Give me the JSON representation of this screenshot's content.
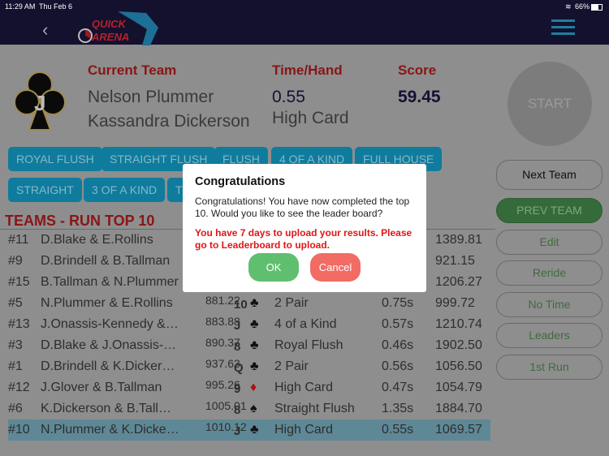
{
  "status": {
    "time": "11:29 AM",
    "date": "Thu Feb 6",
    "battery": "66%"
  },
  "header": {
    "logo_text": "QUICK ARENA",
    "back_icon": "chevron-left-icon",
    "menu_icon": "hamburger-icon"
  },
  "current": {
    "team_label": "Current Team",
    "member1": "Nelson Plummer",
    "member2": "Kassandra Dickerson",
    "time_label": "Time/Hand",
    "time": "0.55",
    "hand": "High Card",
    "score_label": "Score",
    "score": "59.45",
    "card_icon": "jack-of-clubs"
  },
  "hands": [
    "ROYAL FLUSH",
    "STRAIGHT FLUSH",
    "FLUSH",
    "4 OF A KIND",
    "FULL HOUSE",
    "STRAIGHT",
    "3 OF A KIND",
    "T"
  ],
  "list_title": "TEAMS - RUN TOP 10",
  "rows": [
    {
      "rank": "#11",
      "name": "D.Blake & E.Rollins",
      "time": "",
      "card": "",
      "suit": "",
      "hand": "",
      "th": "",
      "score": "1389.81"
    },
    {
      "rank": "#9",
      "name": "D.Brindell & B.Tallman",
      "time": "",
      "card": "",
      "suit": "",
      "hand": "",
      "th": "",
      "score": "921.15"
    },
    {
      "rank": "#15",
      "name": "B.Tallman & N.Plummer",
      "time": "",
      "card": "",
      "suit": "",
      "hand": "",
      "th": "",
      "score": "1206.27"
    },
    {
      "rank": "#5",
      "name": "N.Plummer & E.Rollins",
      "time": "881.22",
      "card": "10",
      "suit": "♣",
      "hand": "2 Pair",
      "th": "0.75s",
      "score": "999.72"
    },
    {
      "rank": "#13",
      "name": "J.Onassis-Kennedy & K.Dickerson",
      "time": "883.88",
      "card": "J",
      "suit": "♣",
      "hand": "4 of a Kind",
      "th": "0.57s",
      "score": "1210.74"
    },
    {
      "rank": "#3",
      "name": "D.Blake & J.Onassis-Kennedy",
      "time": "890.37",
      "card": "8",
      "suit": "♣",
      "hand": "Royal Flush",
      "th": "0.46s",
      "score": "1902.50"
    },
    {
      "rank": "#1",
      "name": "D.Brindell & K.Dickerson",
      "time": "937.63",
      "card": "Q",
      "suit": "♣",
      "hand": "2 Pair",
      "th": "0.56s",
      "score": "1056.50"
    },
    {
      "rank": "#12",
      "name": "J.Glover & B.Tallman",
      "time": "995.26",
      "card": "9",
      "suit": "♦",
      "hand": "High Card",
      "th": "0.47s",
      "score": "1054.79"
    },
    {
      "rank": "#6",
      "name": "K.Dickerson & B.Tallman",
      "time": "1005.01",
      "card": "8",
      "suit": "♠",
      "hand": "Straight Flush",
      "th": "1.35s",
      "score": "1884.70"
    },
    {
      "rank": "#10",
      "name": "N.Plummer & K.Dickerson",
      "time": "1010.12",
      "card": "J",
      "suit": "♣",
      "hand": "High Card",
      "th": "0.55s",
      "score": "1069.57",
      "selected": true
    }
  ],
  "side": {
    "start": "START",
    "next": "Next Team",
    "prev": "PREV TEAM",
    "edit": "Edit",
    "reride": "Reride",
    "notime": "No Time",
    "leaders": "Leaders",
    "first": "1st Run"
  },
  "modal": {
    "title": "Congratulations",
    "body": "Congratulations! You have now completed the top 10. Would you like to see the leader board?",
    "warning": "You have 7 days to upload your results. Please go to Leaderboard to upload.",
    "ok": "OK",
    "cancel": "Cancel"
  },
  "colors": {
    "header": "#14112f",
    "accent": "#0f7c9e",
    "ok": "#5fbf6f",
    "cancel": "#f26b64",
    "warning": "#e21515"
  }
}
